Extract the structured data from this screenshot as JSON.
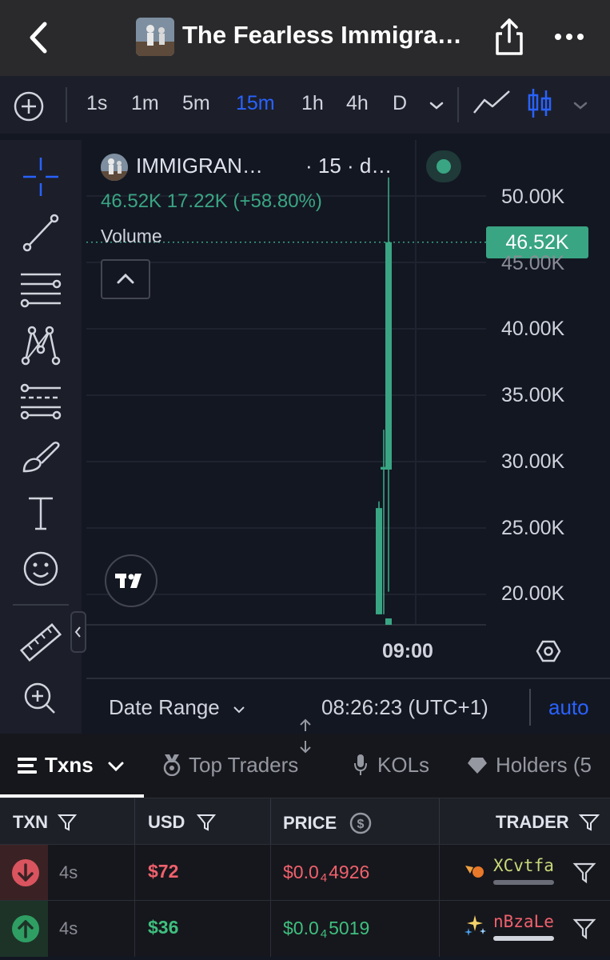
{
  "header": {
    "title": "The Fearless Immigra…"
  },
  "toolbar": {
    "timeframes": [
      "1s",
      "1m",
      "5m",
      "15m",
      "1h",
      "4h",
      "D"
    ],
    "active_timeframe": "15m"
  },
  "legend": {
    "symbol": "IMMIGRAN…",
    "interval": "· 15 · d…",
    "values": "46.52K  17.22K (+58.80%)",
    "volume_label": "Volume"
  },
  "chart_data": {
    "type": "candlestick",
    "price_label": "46.52K",
    "y_ticks": [
      "50.00K",
      "45.00K",
      "40.00K",
      "35.00K",
      "30.00K",
      "25.00K",
      "20.00K"
    ],
    "x_ticks": [
      "09:00"
    ],
    "last_value": 46.52,
    "change_abs": 17.22,
    "change_pct": 58.8,
    "up_color": "#3aa583"
  },
  "date_bar": {
    "date_range_label": "Date Range",
    "clock": "08:26:23 (UTC+1)",
    "auto_label": "auto"
  },
  "tabs": {
    "txns": "Txns",
    "top_traders": "Top Traders",
    "kols": "KOLs",
    "holders": "Holders (5"
  },
  "table": {
    "headers": {
      "txn": "TXN",
      "usd": "USD",
      "price": "PRICE",
      "trader": "TRADER"
    },
    "rows": [
      {
        "type": "sell",
        "age": "4s",
        "usd": "$72",
        "price_prefix": "$0.0",
        "price_zeros": "4",
        "price_digits": "4926",
        "trader": "XCvtfa"
      },
      {
        "type": "buy",
        "age": "4s",
        "usd": "$36",
        "price_prefix": "$0.0",
        "price_zeros": "4",
        "price_digits": "5019",
        "trader": "nBzaLe"
      }
    ]
  },
  "colors": {
    "accent": "#2962ff",
    "up": "#3aa583",
    "sell": "#f0616d",
    "buy": "#3fbf7f"
  }
}
